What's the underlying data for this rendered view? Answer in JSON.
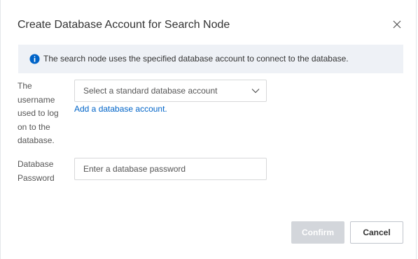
{
  "dialog": {
    "title": "Create Database Account for Search Node",
    "close_icon": "close-icon"
  },
  "notice": {
    "icon": "info-icon",
    "text": "The search node uses the specified database account to connect to the database.",
    "icon_color": "#0064c8"
  },
  "form": {
    "username": {
      "label": "The username used to log on to the database.",
      "select_placeholder": "Select a standard database account",
      "add_link": "Add a database account."
    },
    "password": {
      "label": "Database Password",
      "placeholder": "Enter a database password",
      "value": ""
    }
  },
  "footer": {
    "confirm_label": "Confirm",
    "cancel_label": "Cancel",
    "confirm_enabled": false
  },
  "colors": {
    "link": "#0064c8",
    "notice_bg": "#eef1f6",
    "disabled_button": "#d3d6db"
  }
}
